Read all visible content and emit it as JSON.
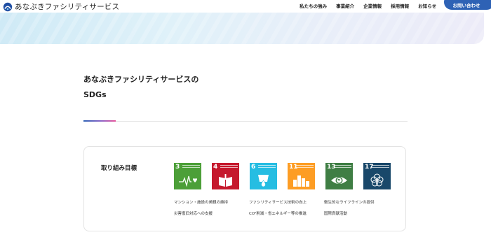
{
  "header": {
    "logo_text": "あなぶきファシリティサービス",
    "nav": [
      "私たちの強み",
      "事業紹介",
      "企業情報",
      "採用情報",
      "お知らせ"
    ],
    "contact_label": "お問い合わせ"
  },
  "section": {
    "title_line1": "あなぶきファシリティサービスの",
    "title_line2": "SDGs"
  },
  "card": {
    "label": "取り組み目標",
    "goals": [
      {
        "number": "3",
        "color": "#4c9f38",
        "icon": "heartbeat-icon"
      },
      {
        "number": "4",
        "color": "#c5192d",
        "icon": "book-icon"
      },
      {
        "number": "6",
        "color": "#26bde2",
        "icon": "water-drop-icon"
      },
      {
        "number": "11",
        "color": "#fd9d24",
        "icon": "city-icon"
      },
      {
        "number": "13",
        "color": "#3f7e44",
        "icon": "eye-globe-icon"
      },
      {
        "number": "17",
        "color": "#19486a",
        "icon": "partnership-flower-icon"
      }
    ],
    "captions": {
      "col1_line1": "マンション・施設の美観の維持",
      "col1_line2": "災害復旧対応への支援",
      "col2_line1": "ファシリティサービス技術の向上",
      "col2_line2": "CO²削減・省エネルギー等の推進",
      "col3_line1": "衛生的なライフラインの提供",
      "col3_line2": "国際貢献活動"
    }
  }
}
